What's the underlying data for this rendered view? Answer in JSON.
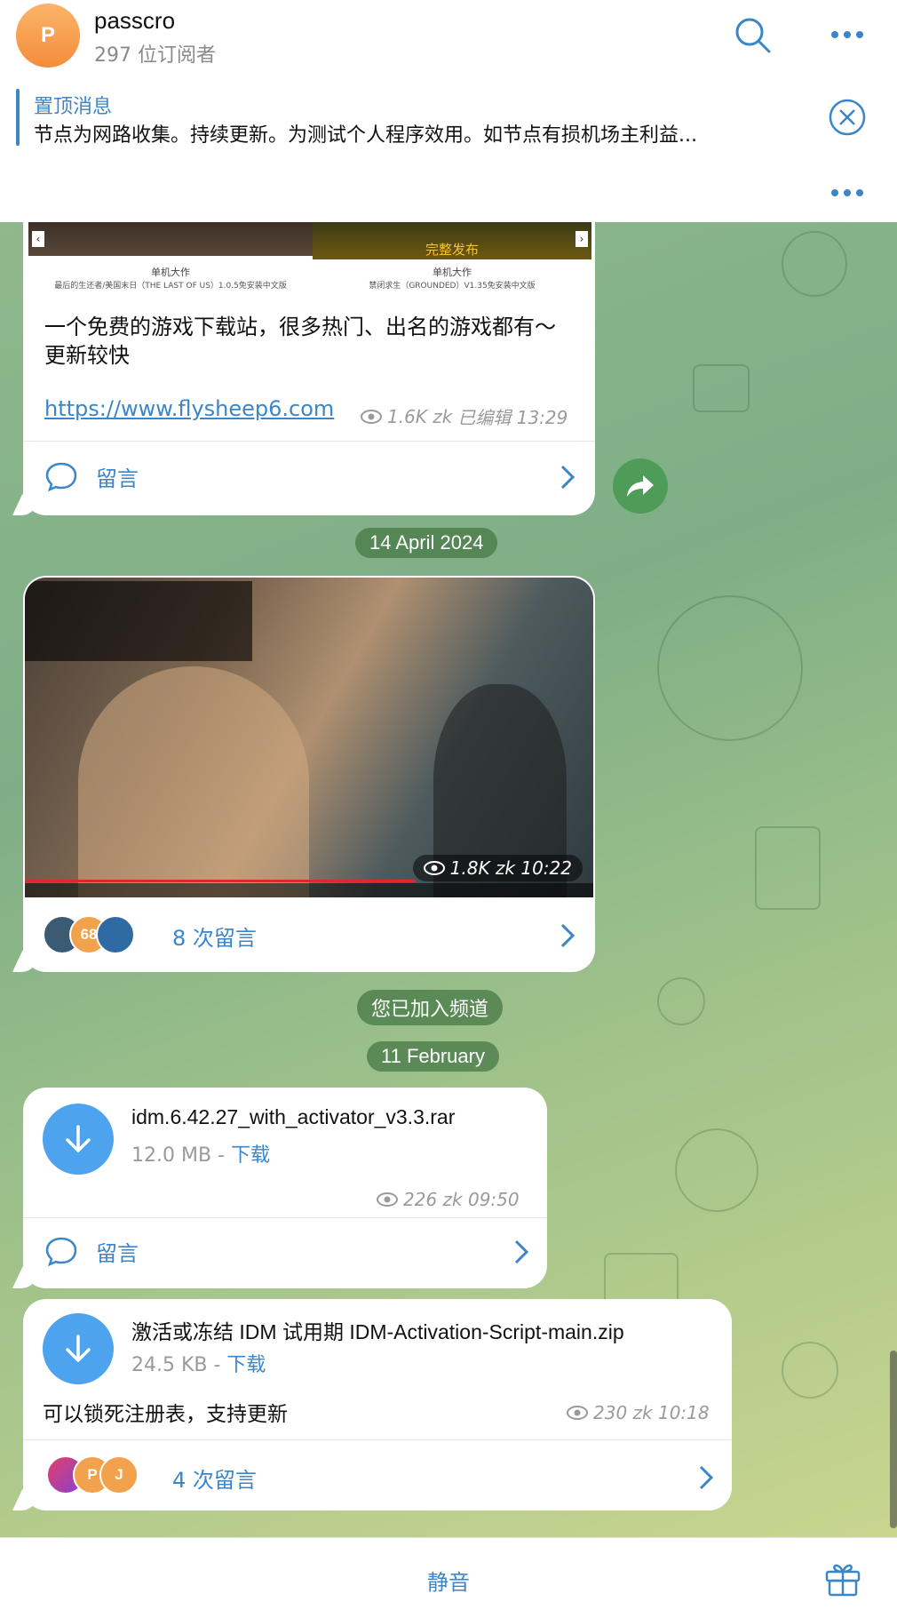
{
  "header": {
    "avatar_letter": "P",
    "channel_name": "passcro",
    "subscribers": "297 位订阅者"
  },
  "pinned": {
    "title": "置顶消息",
    "text": "节点为网路收集。持续更新。为测试个人程序效用。如节点有损机场主利益..."
  },
  "post1": {
    "thumb_left_caption": "最后的生还者/美国末日（THE LAST OF US）1.0.5免安装中文版",
    "thumb_right_caption": "禁闭求生（GROUNDED）V1.35免安装中文版",
    "thumb_brand": "单机大作",
    "thumb_right_banner": "完整发布",
    "body": "一个免费的游戏下载站，很多热门、出名的游戏都有～更新较快",
    "link": "https://www.flysheep6.com",
    "views": "1.6K zk",
    "edited_time": "已编辑 13:29",
    "comment_label": "留言"
  },
  "date1": "14 April 2024",
  "post2": {
    "views_time": "1.8K zk 10:22",
    "avatar_badge": "68",
    "comment_label": "8 次留言"
  },
  "join_notice": "您已加入频道",
  "date2": "11 February",
  "post3": {
    "filename": "idm.6.42.27_with_activator_v3.3.rar",
    "size": "12.0 MB - ",
    "download": "下载",
    "views": "226 zk 09:50",
    "comment_label": "留言"
  },
  "post4": {
    "filename": "激活或冻结 IDM 试用期 IDM-Activation-Script-main.zip",
    "size": "24.5 KB - ",
    "download": "下载",
    "body": "可以锁死注册表，支持更新",
    "views": "230 zk 10:18",
    "avatar_p": "P",
    "avatar_j": "J",
    "comment_label": "4 次留言"
  },
  "bottom": {
    "mute_label": "静音"
  },
  "colors": {
    "accent": "#3a86c8",
    "download_blue": "#4ea3ef",
    "forward_green": "#4f9b58"
  }
}
